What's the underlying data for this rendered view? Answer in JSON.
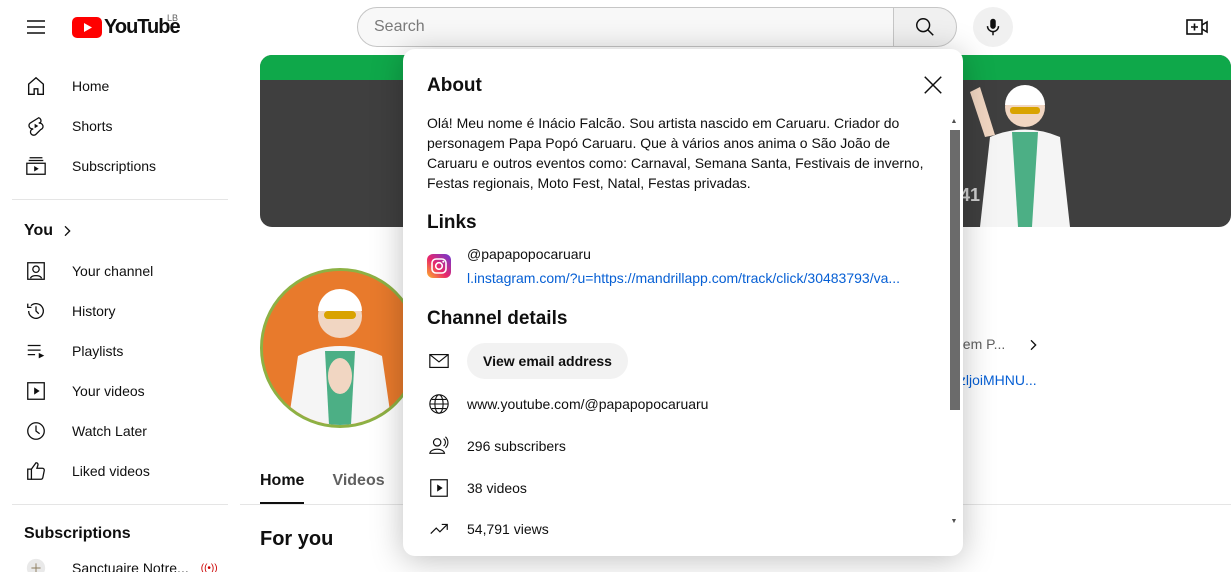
{
  "topbar": {
    "logo_text": "YouTube",
    "logo_country": "LB",
    "search_placeholder": "Search"
  },
  "sidebar": {
    "main_items": [
      {
        "label": "Home",
        "icon": "home-icon"
      },
      {
        "label": "Shorts",
        "icon": "shorts-icon"
      },
      {
        "label": "Subscriptions",
        "icon": "subscriptions-icon"
      }
    ],
    "you_heading": "You",
    "you_items": [
      {
        "label": "Your channel",
        "icon": "your-channel-icon"
      },
      {
        "label": "History",
        "icon": "history-icon"
      },
      {
        "label": "Playlists",
        "icon": "playlists-icon"
      },
      {
        "label": "Your videos",
        "icon": "your-videos-icon"
      },
      {
        "label": "Watch Later",
        "icon": "watch-later-icon"
      },
      {
        "label": "Liked videos",
        "icon": "liked-videos-icon"
      }
    ],
    "subscriptions_heading": "Subscriptions",
    "subscription_items": [
      {
        "label": "Sanctuaire Notre..."
      }
    ]
  },
  "channel_page": {
    "banner_count_fragment": "41",
    "description_fragment": "gem P...",
    "link_fragment": "/zljoiMHNU...",
    "tabs": [
      "Home",
      "Videos"
    ],
    "active_tab": "Home",
    "section_title": "For you"
  },
  "about_modal": {
    "title": "About",
    "description": "Olá! Meu nome é Inácio Falcão. Sou artista nascido em Caruaru. Criador do personagem Papa Popó Caruaru. Que à vários anos anima o São João de Caruaru e outros eventos como: Carnaval, Semana Santa, Festivais de inverno, Festas regionais, Moto Fest, Natal, Festas privadas.",
    "links_heading": "Links",
    "links": [
      {
        "title": "@papapopocaruaru",
        "url": "l.instagram.com/?u=https://mandrillapp.com/track/click/30483793/va...",
        "icon": "instagram-icon"
      }
    ],
    "details_heading": "Channel details",
    "email_button": "View email address",
    "channel_url": "www.youtube.com/@papapopocaruaru",
    "subscribers": "296 subscribers",
    "videos": "38 videos",
    "views": "54,791 views"
  },
  "colors": {
    "accent_red": "#ff0000",
    "link_blue": "#065fd4",
    "banner_green": "#0fa84a"
  }
}
